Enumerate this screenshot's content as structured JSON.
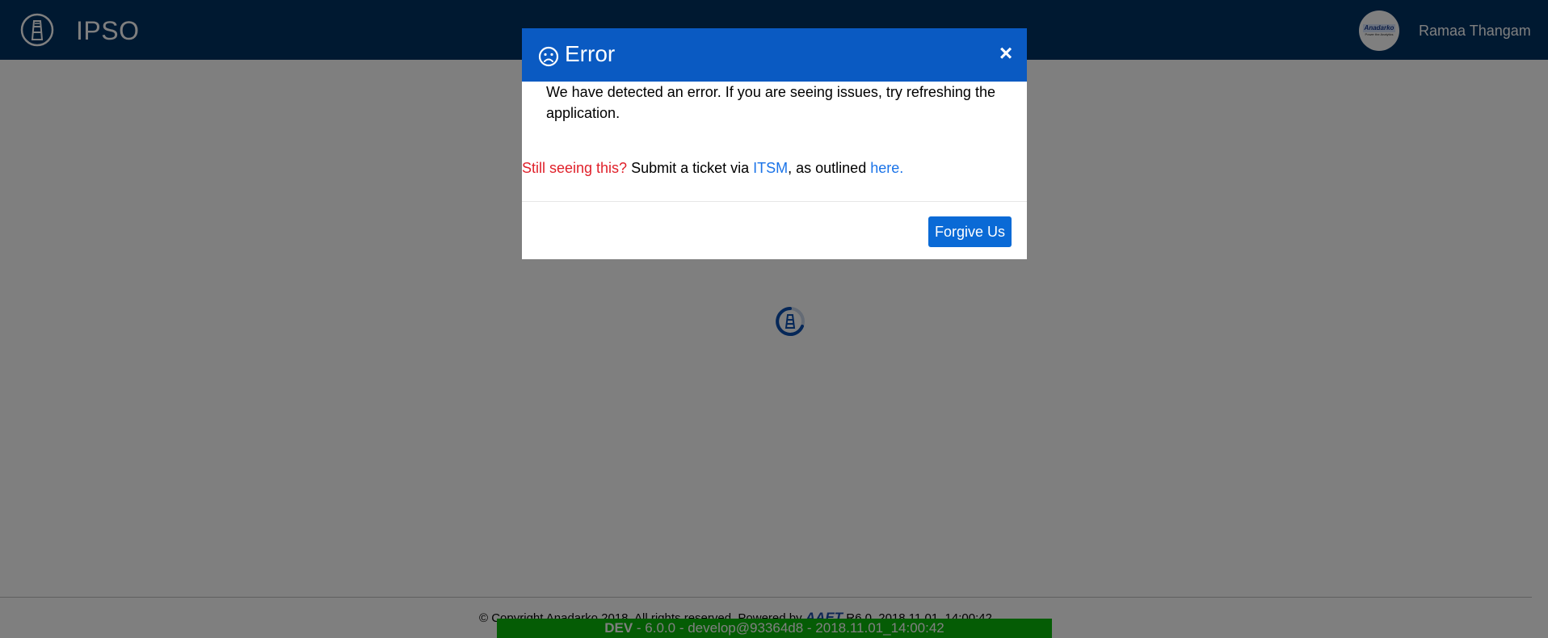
{
  "app": {
    "title": "IPSO",
    "user_name": "Ramaa Thangam",
    "avatar_logo": "Anadarko",
    "avatar_subtext": "Power the Analytics"
  },
  "footer": {
    "copyright_prefix": "© Copyright Anadarko 2018. All rights reserved. Powered by ",
    "powered_by": "AAET",
    "copyright_suffix": " R6.0_2018.11.01_14:00:42",
    "env_label": "DEV",
    "env_details": " - 6.0.0 - develop@93364d8 - 2018.11.01_14:00:42"
  },
  "modal": {
    "title": "Error",
    "close_symbol": "×",
    "message": "We have detected an error. If you are seeing issues, try refreshing the application.",
    "still_seeing": "Still seeing this?",
    "submit_text": " Submit a ticket via ",
    "itsm_link": "ITSM",
    "outlined_text": ", as outlined ",
    "here_link": "here.",
    "button_label": "Forgive Us"
  },
  "colors": {
    "header_bg": "#003263",
    "modal_header_bg": "#0a5ac2",
    "button_bg": "#0a6ad6",
    "alert_red": "#e0202a",
    "link_blue": "#1a73e8",
    "env_banner_bg": "#0bb80b"
  },
  "icons": {
    "brand": "derrick-icon",
    "modal_title": "sad-face-icon",
    "close": "close-icon",
    "spinner": "loading-spinner-icon"
  }
}
